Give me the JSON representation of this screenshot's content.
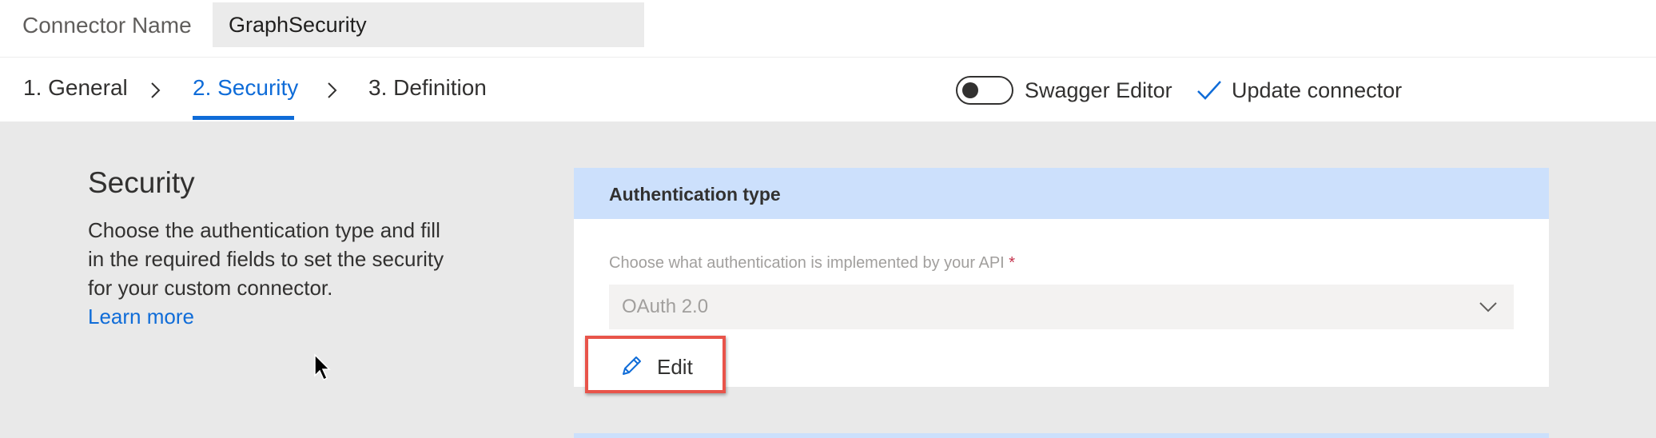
{
  "connector": {
    "name_label": "Connector Name",
    "name_value": "GraphSecurity"
  },
  "steps": [
    {
      "label": "1. General",
      "active": false
    },
    {
      "label": "2. Security",
      "active": true
    },
    {
      "label": "3. Definition",
      "active": false
    }
  ],
  "toolbar": {
    "swagger_label": "Swagger Editor",
    "swagger_on": false,
    "update_label": "Update connector"
  },
  "security": {
    "title": "Security",
    "description": "Choose the authentication type and fill in the required fields to set the security for your custom connector.",
    "learn_more": "Learn more"
  },
  "auth_card": {
    "header": "Authentication type",
    "field_label": "Choose what authentication is implemented by your API",
    "required_mark": "*",
    "selected_value": "OAuth 2.0",
    "edit_label": "Edit"
  },
  "colors": {
    "accent": "#0f6cd8",
    "card_header": "#cce0fc",
    "highlight_border": "#e8544a",
    "main_bg": "#e9e9e9"
  },
  "icons": {
    "step_separator": "chevron-right-icon",
    "update": "checkmark-icon",
    "select": "chevron-down-icon",
    "edit": "pencil-icon",
    "pointer": "mouse-pointer-icon"
  }
}
